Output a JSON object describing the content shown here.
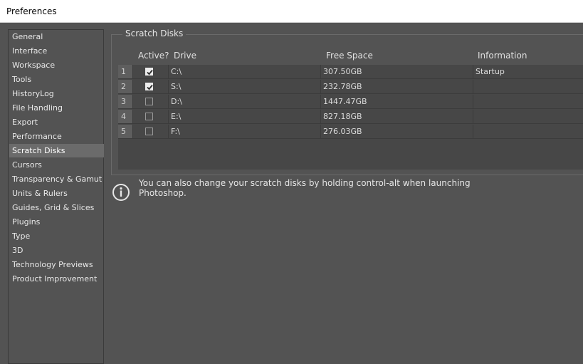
{
  "window": {
    "title": "Preferences"
  },
  "sidebar": {
    "items": [
      {
        "label": "General",
        "selected": false
      },
      {
        "label": "Interface",
        "selected": false
      },
      {
        "label": "Workspace",
        "selected": false
      },
      {
        "label": "Tools",
        "selected": false
      },
      {
        "label": "HistoryLog",
        "selected": false
      },
      {
        "label": "File Handling",
        "selected": false
      },
      {
        "label": "Export",
        "selected": false
      },
      {
        "label": "Performance",
        "selected": false
      },
      {
        "label": "Scratch Disks",
        "selected": true
      },
      {
        "label": "Cursors",
        "selected": false
      },
      {
        "label": "Transparency & Gamut",
        "selected": false
      },
      {
        "label": "Units & Rulers",
        "selected": false
      },
      {
        "label": "Guides, Grid & Slices",
        "selected": false
      },
      {
        "label": "Plugins",
        "selected": false
      },
      {
        "label": "Type",
        "selected": false
      },
      {
        "label": "3D",
        "selected": false
      },
      {
        "label": "Technology Previews",
        "selected": false
      },
      {
        "label": "Product Improvement",
        "selected": false
      }
    ]
  },
  "scratch_disks": {
    "title": "Scratch Disks",
    "columns": {
      "active": "Active?",
      "drive": "Drive",
      "free_space": "Free Space",
      "information": "Information"
    },
    "rows": [
      {
        "index": "1",
        "active": true,
        "drive": "C:\\",
        "free_space": "307.50GB",
        "information": "Startup"
      },
      {
        "index": "2",
        "active": true,
        "drive": "S:\\",
        "free_space": "232.78GB",
        "information": ""
      },
      {
        "index": "3",
        "active": false,
        "drive": "D:\\",
        "free_space": "1447.47GB",
        "information": ""
      },
      {
        "index": "4",
        "active": false,
        "drive": "E:\\",
        "free_space": "827.18GB",
        "information": ""
      },
      {
        "index": "5",
        "active": false,
        "drive": "F:\\",
        "free_space": "276.03GB",
        "information": ""
      }
    ]
  },
  "hint": {
    "icon": "info-icon",
    "text": "You can also change your scratch disks by holding control-alt when launching Photoshop."
  }
}
